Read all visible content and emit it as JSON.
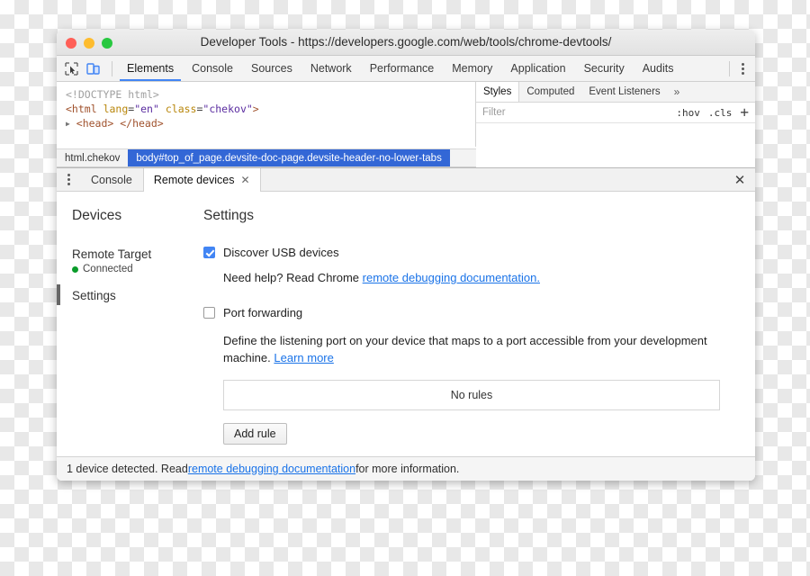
{
  "window": {
    "title": "Developer Tools - https://developers.google.com/web/tools/chrome-devtools/",
    "traffic_lights": [
      "close",
      "minimize",
      "zoom"
    ]
  },
  "toolbar": {
    "inspect_icon": "inspect-cursor-icon",
    "device_icon": "device-toolbar-icon",
    "more_icon": "kebab-menu-icon",
    "tabs": [
      {
        "label": "Elements",
        "active": true
      },
      {
        "label": "Console",
        "active": false
      },
      {
        "label": "Sources",
        "active": false
      },
      {
        "label": "Network",
        "active": false
      },
      {
        "label": "Performance",
        "active": false
      },
      {
        "label": "Memory",
        "active": false
      },
      {
        "label": "Application",
        "active": false
      },
      {
        "label": "Security",
        "active": false
      },
      {
        "label": "Audits",
        "active": false
      }
    ]
  },
  "dom_tree": {
    "lines": [
      {
        "text": "<!DOCTYPE html>",
        "type": "doctype"
      },
      {
        "text": "<html lang=\"en\" class=\"chekov\">",
        "type": "tag"
      },
      {
        "text": "<head> </head>",
        "type": "collapsed"
      }
    ],
    "doctype": "<!DOCTYPE html>",
    "html_open": "<html",
    "attr_lang_name": "lang",
    "attr_lang_value": "\"en\"",
    "attr_class_name": "class",
    "attr_class_value": "\"chekov\"",
    "html_close": ">",
    "head_line": "<head> </head>"
  },
  "breadcrumb": {
    "items": [
      {
        "label": "html.chekov",
        "selected": false
      },
      {
        "label": "body#top_of_page.devsite-doc-page.devsite-header-no-lower-tabs",
        "selected": true
      }
    ]
  },
  "styles_panel": {
    "tabs": [
      {
        "label": "Styles",
        "active": true
      },
      {
        "label": "Computed",
        "active": false
      },
      {
        "label": "Event Listeners",
        "active": false
      }
    ],
    "overflow_icon": "chevron-double-right-icon",
    "filter_placeholder": "Filter",
    "hov_label": ":hov",
    "cls_label": ".cls",
    "new_rule_icon": "plus-icon"
  },
  "drawer": {
    "more_icon": "kebab-menu-icon",
    "tabs": [
      {
        "label": "Console",
        "active": false,
        "closable": false
      },
      {
        "label": "Remote devices",
        "active": true,
        "closable": true
      }
    ],
    "close_tab_icon": "close-icon",
    "close_drawer_icon": "close-icon"
  },
  "remote_devices": {
    "sidebar": {
      "heading": "Devices",
      "items": [
        {
          "label": "Remote Target",
          "status": "Connected",
          "status_color": "#0a9c2a",
          "selected": false
        },
        {
          "label": "Settings",
          "status": null,
          "selected": true
        }
      ]
    },
    "settings": {
      "title": "Settings",
      "discover_usb": {
        "label": "Discover USB devices",
        "checked": true,
        "help_prefix": "Need help? Read Chrome ",
        "help_link": "remote debugging documentation."
      },
      "port_forwarding": {
        "label": "Port forwarding",
        "checked": false,
        "description_before": "Define the listening port on your device that maps to a port accessible from your development machine. ",
        "description_link": "Learn more",
        "empty_rules_text": "No rules",
        "add_rule_label": "Add rule"
      }
    }
  },
  "statusbar": {
    "text_before": "1 device detected. Read ",
    "link": "remote debugging documentation",
    "text_after": " for more information."
  },
  "colors": {
    "accent_blue": "#4285f4",
    "link_blue": "#1a73e8",
    "breadcrumb_selected": "#3367d6",
    "connected_green": "#0a9c2a"
  }
}
